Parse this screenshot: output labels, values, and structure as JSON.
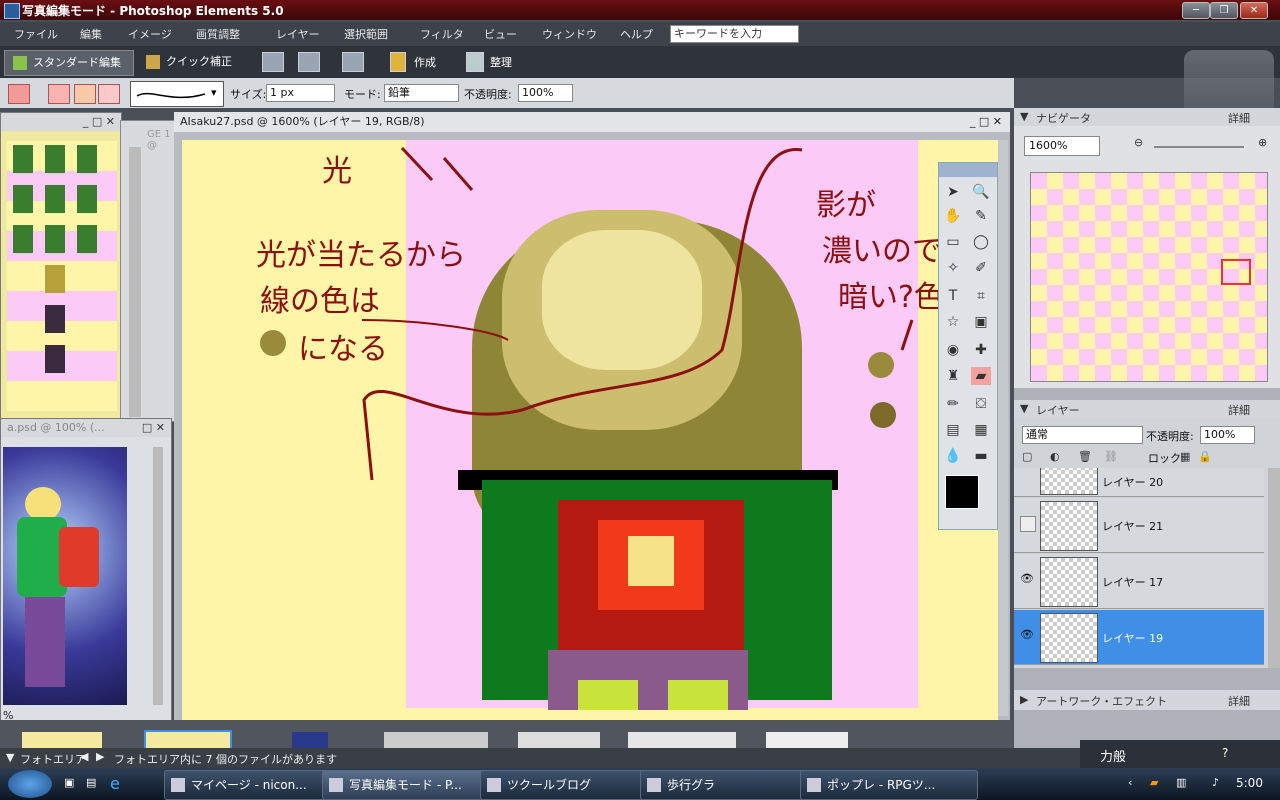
{
  "window": {
    "title": "写真編集モード - Photoshop Elements 5.0"
  },
  "menu": [
    "ファイル",
    "編集",
    "イメージ",
    "画質調整",
    "レイヤー",
    "選択範囲",
    "フィルタ",
    "ビュー",
    "ウィンドウ",
    "ヘルプ"
  ],
  "search": {
    "placeholder": "キーワードを入力"
  },
  "modes": {
    "standard": "スタンダード編集",
    "quick": "クイック補正"
  },
  "toolbar": {
    "create": "作成",
    "organize": "整理"
  },
  "options": {
    "size_label": "サイズ:",
    "size_value": "1 px",
    "mode_label": "モード:",
    "mode_value": "鉛筆",
    "opacity_label": "不透明度:",
    "opacity_value": "100%"
  },
  "document": {
    "title": "AIsaku27.psd @ 1600% (レイヤー 19, RGB/8)"
  },
  "left_panel": {
    "partial_title": "a.psd @ 100% (...",
    "partial_tab": "GE 1 @",
    "percent": "%"
  },
  "navigator": {
    "title": "ナビゲータ",
    "more": "詳細",
    "zoom": "1600%"
  },
  "layers": {
    "title": "レイヤー",
    "more": "詳細",
    "blend_mode": "通常",
    "opacity_label": "不透明度:",
    "opacity_value": "100%",
    "lock_label": "ロック:",
    "items": [
      {
        "name": "レイヤー 20",
        "visible": false,
        "selected": false
      },
      {
        "name": "レイヤー 21",
        "visible": false,
        "selected": false
      },
      {
        "name": "レイヤー 17",
        "visible": true,
        "selected": false
      },
      {
        "name": "レイヤー 19",
        "visible": true,
        "selected": true
      }
    ]
  },
  "artwork": {
    "title": "アートワーク・エフェクト",
    "more": "詳細"
  },
  "status": {
    "photo_area": "フォトエリア",
    "message": "フォトエリア内に 7 個のファイルがあります"
  },
  "annotations": {
    "light": "光",
    "light_hits": "光が当たるから",
    "line_color": "線の色は",
    "becomes": "になる",
    "shadow": "影が",
    "dark": "濃いので",
    "dark_color": "暗い?色"
  },
  "taskbar": {
    "items": [
      "マイページ - nicon...",
      "写真編集モード - P...",
      "ツクールブログ",
      "歩行グラ",
      "ポップレ - RPGツ..."
    ],
    "ime": "力般",
    "clock": "5:00"
  },
  "colors": {
    "accent_selected": "#3f8fe6",
    "canvas_yellow": "#fff5a8",
    "canvas_pink": "#fccaf7",
    "annotation_red": "#8b1010",
    "chip_olive": "#9a8a3c"
  }
}
